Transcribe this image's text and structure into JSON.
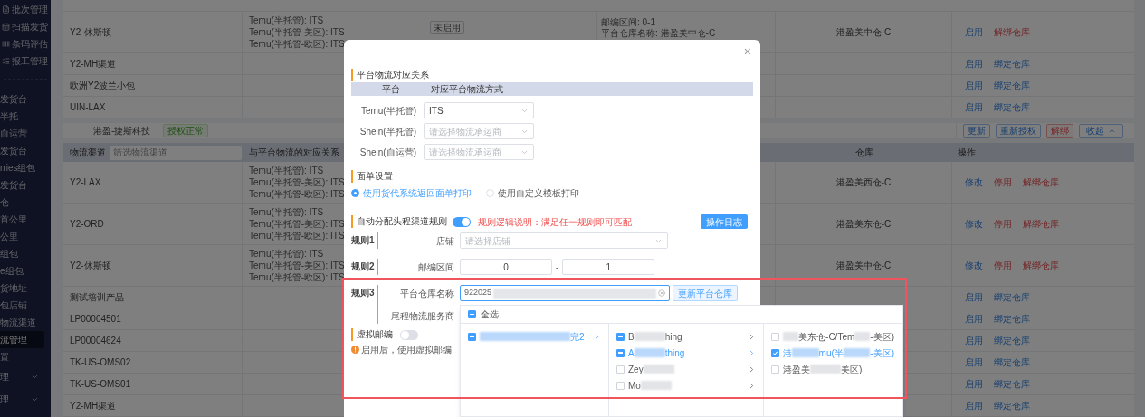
{
  "sidebar": {
    "items": [
      {
        "label": "批次管理",
        "kind": "sub",
        "selected": false
      },
      {
        "label": "扫描发货",
        "kind": "sub",
        "selected": false
      },
      {
        "label": "条码评估",
        "kind": "sub",
        "selected": false
      },
      {
        "label": "报工管理",
        "kind": "sub",
        "selected": false
      },
      {
        "label": "发货台",
        "kind": "link",
        "selected": false
      },
      {
        "label": "半托",
        "kind": "link",
        "selected": false
      },
      {
        "label": "自运营",
        "kind": "link",
        "selected": false
      },
      {
        "label": "发货台",
        "kind": "link",
        "selected": false
      },
      {
        "label": "rries组包",
        "kind": "link",
        "selected": false
      },
      {
        "label": "发货台",
        "kind": "link",
        "selected": false
      },
      {
        "label": "仓",
        "kind": "link",
        "selected": false
      },
      {
        "label": "首公里",
        "kind": "link",
        "selected": false
      },
      {
        "label": "公里",
        "kind": "link",
        "selected": false
      },
      {
        "label": "组包",
        "kind": "link",
        "selected": false
      },
      {
        "label": "e组包",
        "kind": "link",
        "selected": false
      },
      {
        "label": "货地址",
        "kind": "link",
        "selected": false
      },
      {
        "label": "包店铺",
        "kind": "link",
        "selected": false
      },
      {
        "label": "物流渠道",
        "kind": "link",
        "selected": false
      },
      {
        "label": "流管理",
        "kind": "link",
        "selected": true
      },
      {
        "label": "置",
        "kind": "link",
        "selected": false
      },
      {
        "label": "理",
        "kind": "group",
        "selected": false
      },
      {
        "label": "理",
        "kind": "group",
        "selected": false
      }
    ]
  },
  "upper_table": {
    "rows": [
      {
        "channel": "Y2-休斯顿",
        "relation": [
          "Temu(半托管): ITS",
          "Temu(半托管-美区): ITS",
          "Temu(半托管-欧区): ITS"
        ],
        "tag": "未启用",
        "rules": [
          "邮编区间: 0-1",
          "平台仓库名称: 港盈美中仓-C"
        ],
        "warehouse": "港盈美中仓-C",
        "actions": [
          {
            "label": "启用",
            "kind": "primary"
          },
          {
            "label": "解绑仓库",
            "kind": "danger"
          }
        ]
      },
      {
        "channel": "Y2-MH渠道",
        "actions": [
          {
            "label": "启用",
            "kind": "primary"
          },
          {
            "label": "绑定仓库",
            "kind": "primary"
          }
        ]
      },
      {
        "channel": "欧洲Y2波兰小包",
        "actions": [
          {
            "label": "启用",
            "kind": "primary"
          },
          {
            "label": "绑定仓库",
            "kind": "primary"
          }
        ]
      },
      {
        "channel": "UIN-LAX",
        "actions": [
          {
            "label": "启用",
            "kind": "primary"
          },
          {
            "label": "绑定仓库",
            "kind": "primary"
          }
        ]
      }
    ]
  },
  "store_bar": {
    "name": "港盈-捷斯科技",
    "status": "授权正常",
    "buttons": [
      {
        "label": "更新",
        "kind": "default"
      },
      {
        "label": "重新授权",
        "kind": "default"
      },
      {
        "label": "解绑",
        "kind": "danger"
      },
      {
        "label": "收起",
        "kind": "collapse"
      }
    ]
  },
  "lower_table": {
    "columns": [
      "物流渠道",
      "与平台物流的对应关系",
      "仓库",
      "操作"
    ],
    "filter_placeholder": "筛选物流渠道",
    "rows": [
      {
        "channel": "Y2-LAX",
        "relation": [
          "Temu(半托管): ITS",
          "Temu(半托管-美区): ITS",
          "Temu(半托管-欧区): ITS"
        ],
        "warehouse": "港盈美西仓-C",
        "actions": [
          {
            "label": "修改",
            "kind": "primary"
          },
          {
            "label": "停用",
            "kind": "danger"
          },
          {
            "label": "解绑仓库",
            "kind": "danger"
          }
        ]
      },
      {
        "channel": "Y2-ORD",
        "relation": [
          "Temu(半托管): ITS",
          "Temu(半托管-美区): ITS",
          "Temu(半托管-欧区): ITS"
        ],
        "warehouse": "港盈美东仓-C",
        "actions": [
          {
            "label": "修改",
            "kind": "primary"
          },
          {
            "label": "停用",
            "kind": "danger"
          },
          {
            "label": "解绑仓库",
            "kind": "danger"
          }
        ]
      },
      {
        "channel": "Y2-休斯顿",
        "relation": [
          "Temu(半托管): ITS",
          "Temu(半托管-美区): ITS",
          "Temu(半托管-欧区): ITS"
        ],
        "warehouse": "港盈美中仓-C",
        "actions": [
          {
            "label": "修改",
            "kind": "primary"
          },
          {
            "label": "停用",
            "kind": "danger"
          },
          {
            "label": "解绑仓库",
            "kind": "danger"
          }
        ]
      },
      {
        "channel": "测试培训产品",
        "actions": [
          {
            "label": "启用",
            "kind": "primary"
          },
          {
            "label": "绑定仓库",
            "kind": "primary"
          }
        ]
      },
      {
        "channel": "LP00004501",
        "actions": [
          {
            "label": "启用",
            "kind": "primary"
          },
          {
            "label": "绑定仓库",
            "kind": "primary"
          }
        ]
      },
      {
        "channel": "LP00004624",
        "actions": [
          {
            "label": "启用",
            "kind": "primary"
          },
          {
            "label": "绑定仓库",
            "kind": "primary"
          }
        ]
      },
      {
        "channel": "TK-US-OMS02",
        "actions": [
          {
            "label": "启用",
            "kind": "primary"
          },
          {
            "label": "绑定仓库",
            "kind": "primary"
          }
        ]
      },
      {
        "channel": "TK-US-OMS01",
        "actions": [
          {
            "label": "启用",
            "kind": "primary"
          },
          {
            "label": "绑定仓库",
            "kind": "primary"
          }
        ]
      },
      {
        "channel": "Y2-MH渠道",
        "actions": [
          {
            "label": "启用",
            "kind": "primary"
          },
          {
            "label": "绑定仓库",
            "kind": "primary"
          }
        ]
      }
    ]
  },
  "modal": {
    "close": "×",
    "mapping": {
      "title": "平台物流对应关系",
      "columns": [
        "平台",
        "对应平台物流方式"
      ],
      "rows": [
        {
          "platform": "Temu(半托管)",
          "value": "ITS"
        },
        {
          "platform": "Shein(半托管)",
          "placeholder": "请选择物流承运商"
        },
        {
          "platform": "Shein(自运营)",
          "placeholder": "请选择物流承运商"
        }
      ]
    },
    "label_settings": {
      "title": "面单设置",
      "options": [
        {
          "label": "使用货代系统返回面单打印",
          "selected": true
        },
        {
          "label": "使用自定义模板打印",
          "selected": false
        }
      ]
    },
    "auto_rules": {
      "title": "自动分配头程渠道规则",
      "on": true,
      "note": "规则逻辑说明：满足任一规则即可匹配",
      "log_button": "操作日志",
      "rules": [
        {
          "label": "规则1",
          "fields": [
            {
              "kind": "select",
              "label": "店铺",
              "placeholder": "请选择店铺"
            }
          ]
        },
        {
          "label": "规则2",
          "fields": [
            {
              "kind": "range",
              "label": "邮编区间",
              "from": "0",
              "separator": "-",
              "to": "1"
            }
          ]
        },
        {
          "label": "规则3",
          "fields": [
            {
              "kind": "search",
              "label": "平台仓库名称",
              "value": "922025",
              "value_redacted": true,
              "button": "更新平台仓库"
            },
            {
              "kind": "cascader",
              "label": "尾程物流服务商"
            }
          ]
        }
      ]
    },
    "virtual_zip": {
      "title": "虚拟邮编",
      "on": false,
      "warning": "启用后，使用虚拟邮编"
    }
  },
  "cascader": {
    "select_all": {
      "label": "全选",
      "indeterminate": true
    },
    "columns": [
      [
        {
          "fragments": [
            {
              "kind": "redacted"
            },
            {
              "kind": "text",
              "text": "完2"
            }
          ],
          "checked": false,
          "indeterminate": true,
          "selected": true,
          "has_children": true
        }
      ],
      [
        {
          "fragments": [
            {
              "kind": "text",
              "text": "B"
            },
            {
              "kind": "redacted"
            },
            {
              "kind": "text",
              "text": "hing"
            }
          ],
          "checked": false,
          "indeterminate": true,
          "selected": false,
          "has_children": true
        },
        {
          "fragments": [
            {
              "kind": "text",
              "text": "A"
            },
            {
              "kind": "redacted"
            },
            {
              "kind": "text",
              "text": "thing"
            }
          ],
          "checked": false,
          "indeterminate": true,
          "selected": true,
          "has_children": true
        },
        {
          "fragments": [
            {
              "kind": "text",
              "text": "Zey"
            },
            {
              "kind": "redacted"
            }
          ],
          "checked": false,
          "indeterminate": false,
          "selected": false,
          "has_children": true
        },
        {
          "fragments": [
            {
              "kind": "text",
              "text": "Mo"
            },
            {
              "kind": "redacted"
            }
          ],
          "checked": false,
          "indeterminate": false,
          "selected": false,
          "has_children": true
        }
      ],
      [
        {
          "fragments": [
            {
              "kind": "redacted"
            },
            {
              "kind": "text",
              "text": "美东仓-C/Tem"
            },
            {
              "kind": "redacted"
            },
            {
              "kind": "text",
              "text": "-美区)"
            }
          ],
          "checked": false,
          "has_children": false
        },
        {
          "fragments": [
            {
              "kind": "text",
              "text": "港"
            },
            {
              "kind": "redacted"
            },
            {
              "kind": "text",
              "text": "mu(半"
            },
            {
              "kind": "redacted"
            },
            {
              "kind": "text",
              "text": "-美区)"
            }
          ],
          "checked": true,
          "has_children": false
        },
        {
          "fragments": [
            {
              "kind": "text",
              "text": "港盈美"
            },
            {
              "kind": "redacted"
            },
            {
              "kind": "text",
              "text": "美区)"
            }
          ],
          "checked": false,
          "has_children": false
        }
      ]
    ]
  }
}
